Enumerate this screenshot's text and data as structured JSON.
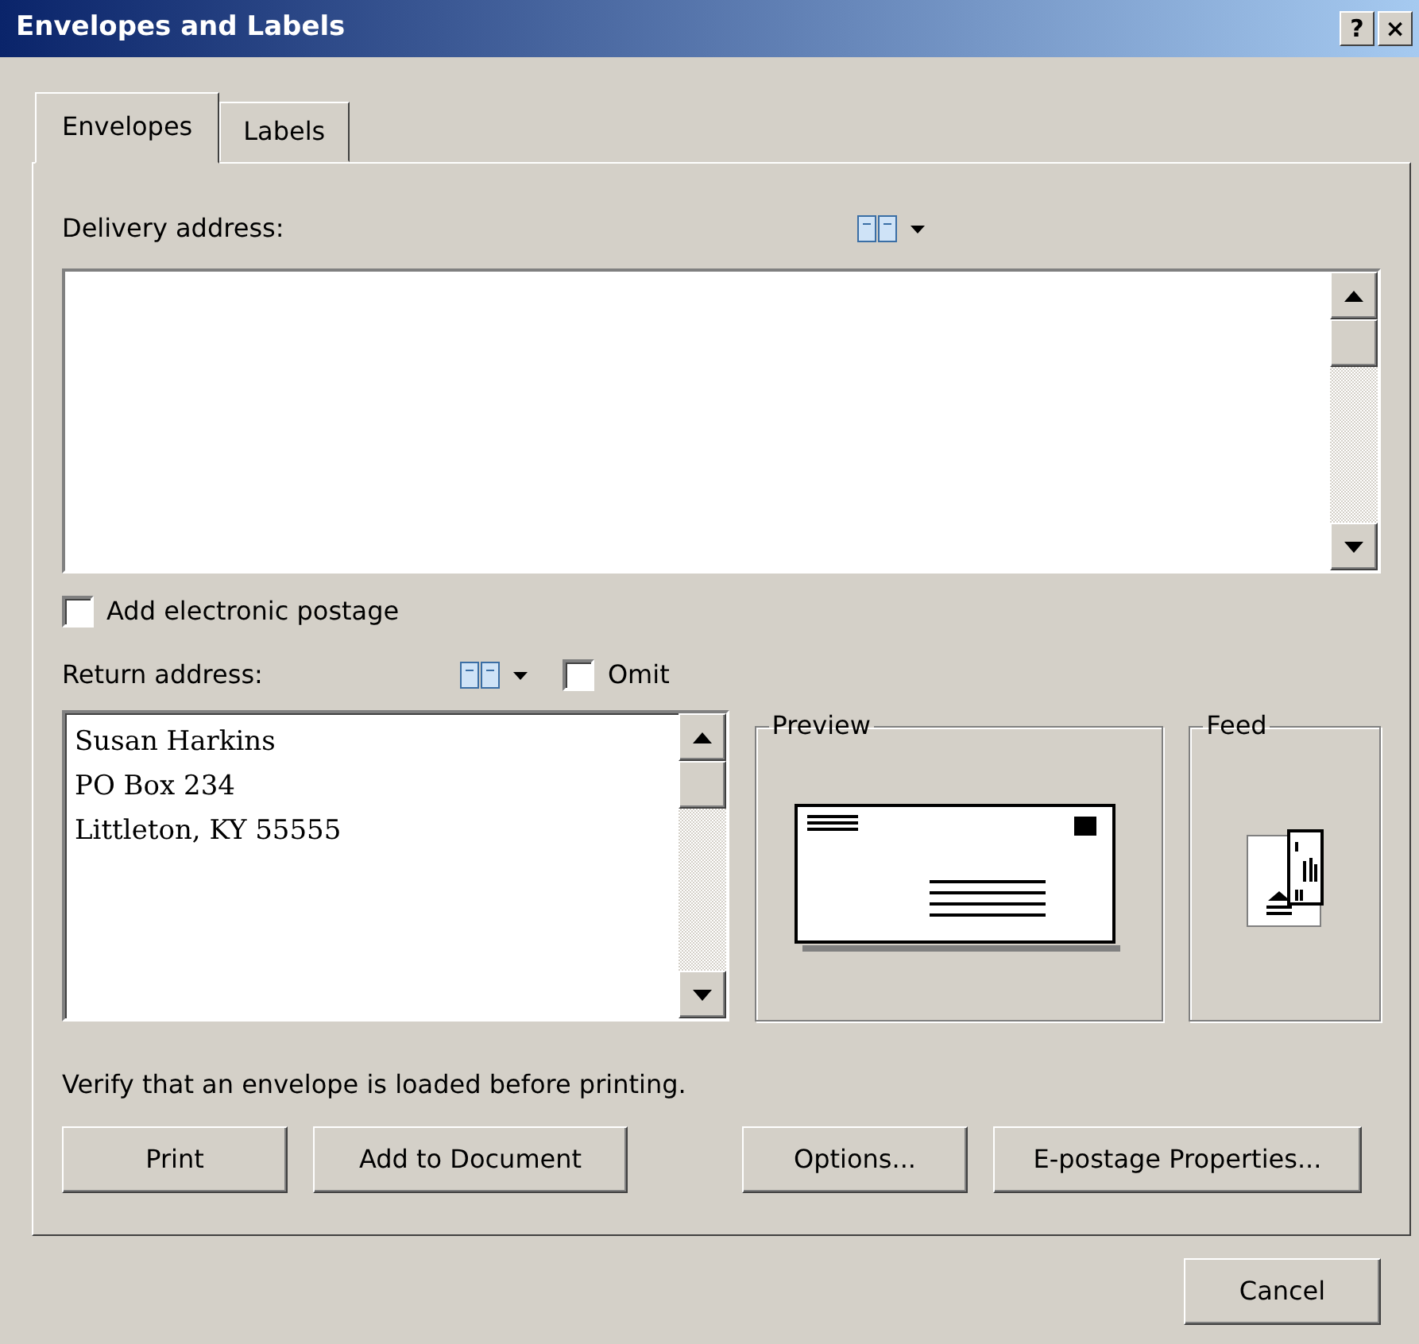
{
  "window": {
    "title": "Envelopes and Labels",
    "title_buttons": [
      "?",
      "×"
    ]
  },
  "tabs": [
    {
      "label": "Envelopes",
      "selected": true
    },
    {
      "label": "Labels",
      "selected": false
    }
  ],
  "delivery": {
    "label": "Delivery address:"
  },
  "electronic_postage": {
    "label": "Add electronic postage",
    "checked": false
  },
  "return": {
    "label": "Return address:",
    "omit": {
      "label": "Omit",
      "checked": false
    },
    "lines": [
      "Susan Harkins",
      "PO Box 234",
      "Littleton, KY 55555"
    ]
  },
  "preview": {
    "title": "Preview"
  },
  "feed": {
    "title": "Feed"
  },
  "note": "Verify that an envelope is loaded before printing.",
  "buttons": [
    {
      "label": "Print"
    },
    {
      "label": "Add to Document"
    },
    {
      "label": "Options..."
    },
    {
      "label": "E-postage Properties..."
    }
  ],
  "footer_buttons": [
    {
      "label": "Cancel"
    }
  ]
}
